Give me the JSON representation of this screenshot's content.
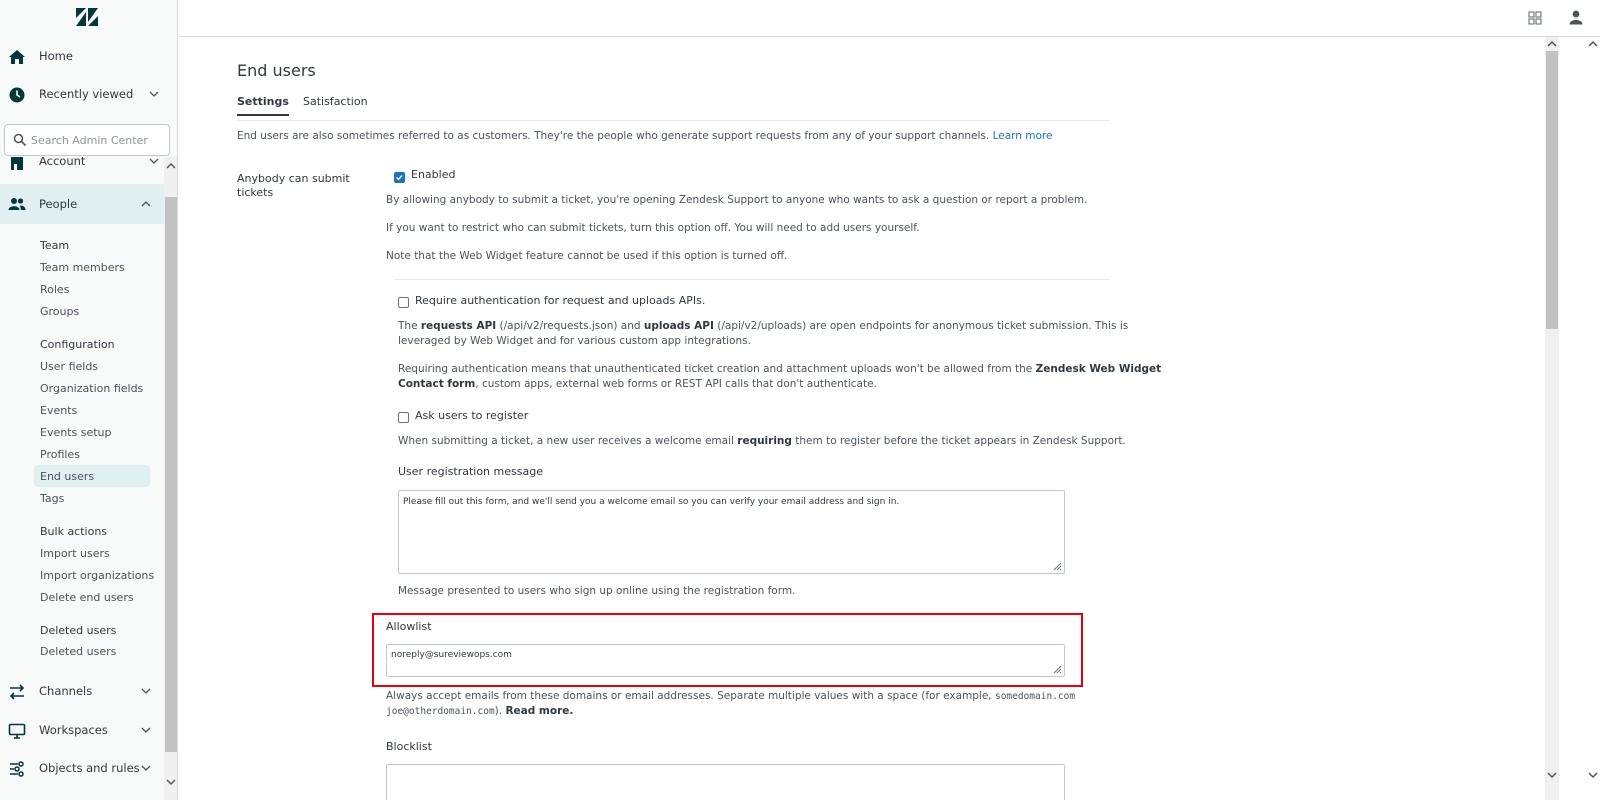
{
  "sidebar": {
    "home_label": "Home",
    "recently_viewed_label": "Recently viewed",
    "search_placeholder": "Search Admin Center",
    "account_label": "Account",
    "people_label": "People",
    "groups": [
      {
        "heading": "Team",
        "items": [
          "Team members",
          "Roles",
          "Groups"
        ]
      },
      {
        "heading": "Configuration",
        "items": [
          "User fields",
          "Organization fields",
          "Events",
          "Events setup",
          "Profiles",
          "End users",
          "Tags"
        ]
      },
      {
        "heading": "Bulk actions",
        "items": [
          "Import users",
          "Import organizations",
          "Delete end users"
        ]
      },
      {
        "heading": "Deleted users",
        "items": [
          "Deleted users"
        ]
      }
    ],
    "active_item": "End users",
    "channels_label": "Channels",
    "workspaces_label": "Workspaces",
    "objects_rules_label": "Objects and rules"
  },
  "page": {
    "title": "End users",
    "tabs": [
      {
        "label": "Settings",
        "active": true
      },
      {
        "label": "Satisfaction",
        "active": false
      }
    ],
    "intro_text": "End users are also sometimes referred to as customers. They're the people who generate support requests from any of your support channels.",
    "learn_more": "Learn more",
    "anybody_label": "Anybody can submit tickets",
    "enabled_label": "Enabled",
    "enabled_checked": true,
    "desc1": "By allowing anybody to submit a ticket, you're opening Zendesk Support to anyone who wants to ask a question or report a problem.",
    "desc2": "If you want to restrict who can submit tickets, turn this option off. You will need to add users yourself.",
    "desc3": "Note that the Web Widget feature cannot be used if this option is turned off.",
    "require_auth": {
      "label": "Require authentication for request and uploads APIs.",
      "checked": false,
      "p1_a": "The ",
      "p1_b": "requests API",
      "p1_c": " (/api/v2/requests.json) and ",
      "p1_d": "uploads API",
      "p1_e": " (/api/v2/uploads) are open endpoints for anonymous ticket submission. This is",
      "p1_line2": "leveraged by Web Widget and for various custom app integrations.",
      "p2_a": "Requiring authentication means that unauthenticated ticket creation and attachment uploads won't be allowed from the ",
      "p2_b": "Zendesk Web Widget",
      "p2_c": "Contact form",
      "p2_d": ", custom apps, external web forms or REST API calls that don't authenticate."
    },
    "ask_register": {
      "label": "Ask users to register",
      "checked": false,
      "desc_a": "When submitting a ticket, a new user receives a welcome email ",
      "desc_b": "requiring",
      "desc_c": " them to register before the ticket appears in Zendesk Support."
    },
    "registration": {
      "label": "User registration message",
      "value": "Please fill out this form, and we'll send you a welcome email so you can verify your email address and sign in.",
      "help": "Message presented to users who sign up online using the registration form."
    },
    "allowlist": {
      "label": "Allowlist",
      "value": "noreply@sureviewops.com",
      "help_a": "Always accept emails from these domains or email addresses. Separate multiple values with a space (for example, ",
      "example1": "somedomain.com",
      "example2": "joe@otherdomain.com",
      "help_b": "). ",
      "read_more": "Read more."
    },
    "blocklist": {
      "label": "Blocklist"
    }
  },
  "colors": {
    "highlight": "#e3000f",
    "accent": "#1f73b7",
    "active_bg": "#dfeff2"
  },
  "icons": [
    "zendesk-logo-icon",
    "home-icon",
    "clock-icon",
    "search-icon",
    "building-icon",
    "people-icon",
    "channels-icon",
    "workspaces-icon",
    "objects-rules-icon",
    "apps-grid-icon",
    "user-icon",
    "chevron-down-icon",
    "chevron-up-icon"
  ]
}
